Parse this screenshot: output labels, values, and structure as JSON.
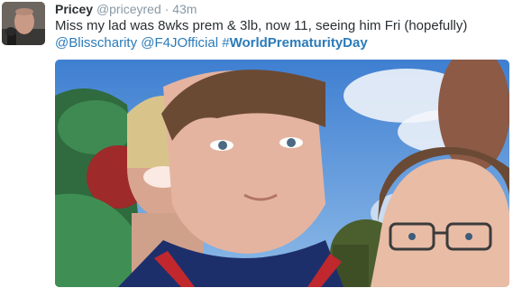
{
  "tweet": {
    "author_name": "Pricey",
    "author_handle": "@priceyred",
    "separator": "·",
    "time": "43m",
    "text": "Miss my lad was 8wks prem & 3lb, now 11, seeing him Fri (hopefully)",
    "mention_1": "@Blisscharity",
    "mention_2": "@F4JOfficial",
    "hashtag_symbol": "#",
    "hashtag_text": "WorldPrematurityDay"
  },
  "colors": {
    "text": "#292f33",
    "meta": "#8899a6",
    "link": "#2b7bb9"
  },
  "icons": {
    "avatar": "profile-photo"
  }
}
